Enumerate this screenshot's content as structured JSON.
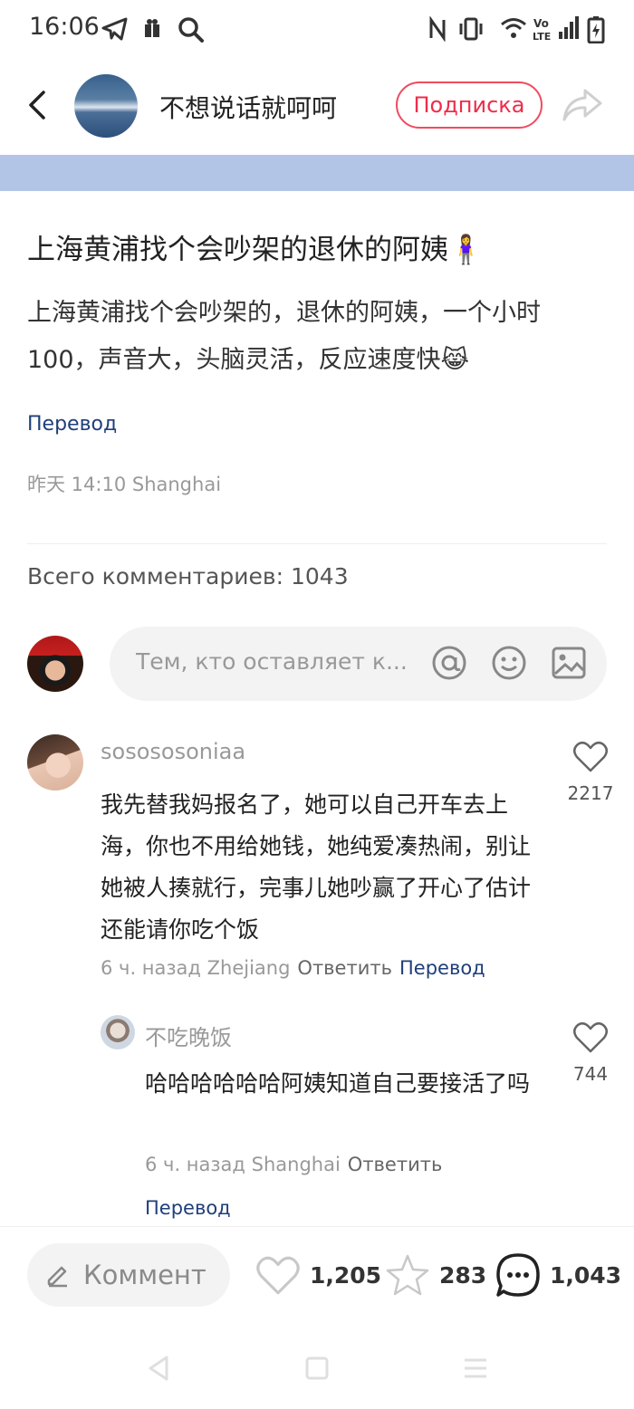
{
  "status_bar": {
    "time": "16:06"
  },
  "header": {
    "author_name": "不想说话就呵呵",
    "subscribe_label": "Подписка"
  },
  "post": {
    "title": "上海黄浦找个会吵架的退休的阿姨🧍‍♀️",
    "body": "上海黄浦找个会吵架的，退休的阿姨，一个小时100，声音大，头脑灵活，反应速度快😹",
    "translate_label": "Перевод",
    "meta": "昨天 14:10 Shanghai"
  },
  "comments_section": {
    "count_label": "Всего комментариев: 1043",
    "input_placeholder": "Тем, кто оставляет к..."
  },
  "comments": [
    {
      "username": "sosososoniaa",
      "text": "我先替我妈报名了，她可以自己开车去上海，你也不用给她钱，她纯爱凑热闹，别让她被人揍就行，完事儿她吵赢了开心了估计还能请你吃个饭",
      "time_location": "6 ч. назад Zhejiang",
      "reply_label": "Ответить",
      "translate_label": "Перевод",
      "likes": "2217"
    },
    {
      "username": "不吃晚饭",
      "text": "哈哈哈哈哈哈阿姨知道自己要接活了吗",
      "time_location": "6 ч. назад Shanghai",
      "reply_label": "Ответить",
      "translate_label": "Перевод",
      "likes": "744"
    }
  ],
  "bottom_bar": {
    "comment_label": "Коммент",
    "likes": "1,205",
    "favorites": "283",
    "comments": "1,043"
  },
  "colors": {
    "accent_red": "#ee2d4a",
    "link_blue": "#1f3f7a",
    "banner": "#b3c5e7"
  },
  "icons": [
    "telegram-icon",
    "gift-icon",
    "search-icon",
    "nfc-icon",
    "vibrate-icon",
    "wifi-icon",
    "volte-icon",
    "signal-icon",
    "battery-icon",
    "back-icon",
    "share-icon",
    "at-icon",
    "emoji-icon",
    "image-icon",
    "heart-icon",
    "star-icon",
    "chat-icon",
    "pencil-icon"
  ]
}
